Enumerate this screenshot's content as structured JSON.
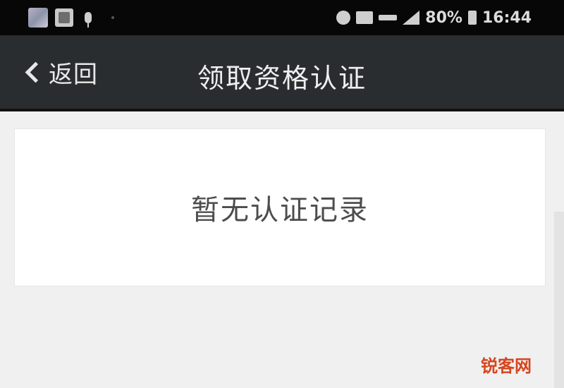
{
  "status_bar": {
    "battery_percent": "80%",
    "time": "16:44",
    "icons": [
      "notification-thumbnail-icon",
      "notification-image-icon",
      "microphone-icon",
      "alarm-icon",
      "mute-icon",
      "nfc-icon",
      "signal-icon",
      "battery-icon"
    ]
  },
  "nav": {
    "back_label": "返回",
    "title": "领取资格认证"
  },
  "content": {
    "empty_message": "暂无认证记录"
  },
  "watermark": {
    "text": "锐客网"
  },
  "colors": {
    "status_bar_bg": "#070707",
    "nav_bg": "#2a2d30",
    "page_bg": "#f0f0f0",
    "card_bg": "#ffffff",
    "watermark": "#d6451e"
  }
}
